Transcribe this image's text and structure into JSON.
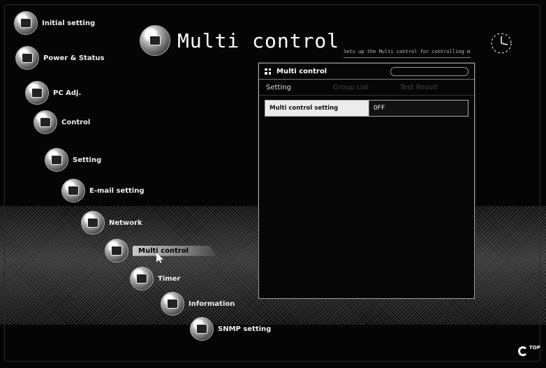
{
  "page": {
    "title": "Multi control",
    "description_text": "Sets up the Multi control for controlling multiple projectors."
  },
  "menu": [
    {
      "label": "Initial setting"
    },
    {
      "label": "Power & Status"
    },
    {
      "label": "PC Adj."
    },
    {
      "label": "Control"
    },
    {
      "label": "Setting"
    },
    {
      "label": "E-mail setting"
    },
    {
      "label": "Network"
    },
    {
      "label": "Multi control"
    },
    {
      "label": "Timer"
    },
    {
      "label": "Information"
    },
    {
      "label": "SNMP setting"
    }
  ],
  "panel": {
    "title": "Multi control",
    "tabs": [
      "Setting",
      "Group List",
      "Test Result"
    ],
    "setting_label": "Multi control setting",
    "setting_value": "OFF"
  },
  "top_link": {
    "label": "TOP"
  },
  "colors": {
    "background": "#050505",
    "panel_border": "#9a9a9a",
    "label_bg": "#ececec"
  }
}
